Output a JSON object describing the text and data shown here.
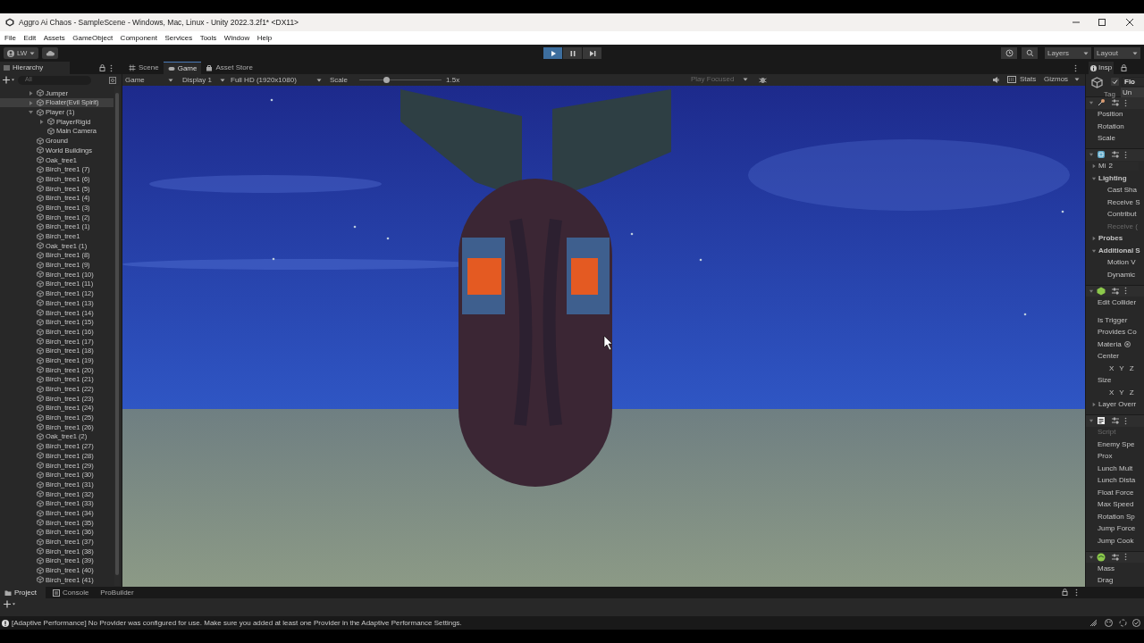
{
  "window": {
    "title": "Aggro Ai Chaos - SampleScene - Windows, Mac, Linux - Unity 2022.3.2f1* <DX11>"
  },
  "menu": [
    "File",
    "Edit",
    "Assets",
    "GameObject",
    "Component",
    "Services",
    "Tools",
    "Window",
    "Help"
  ],
  "toolbar": {
    "account": "LW",
    "play_buttons": [
      {
        "kind": "play",
        "active": true
      },
      {
        "kind": "pause",
        "active": false
      },
      {
        "kind": "step",
        "active": false
      }
    ],
    "layers": "Layers",
    "layout": "Layout"
  },
  "hierarchy": {
    "title": "Hierarchy",
    "search_placeholder": "All",
    "items": [
      {
        "label": "Jumper",
        "expanded": false,
        "selected": false
      },
      {
        "label": "Floater(Evil Spirit)",
        "expanded": false,
        "selected": true
      },
      {
        "label": "Player (1)",
        "expanded": true,
        "selected": false,
        "children": [
          {
            "label": "PlayerRigid",
            "expanded": false,
            "selected": false
          },
          {
            "label": "Main Camera",
            "selected": false
          }
        ]
      },
      {
        "label": "Ground",
        "selected": false
      },
      {
        "label": "World Buildings",
        "selected": false
      },
      {
        "label": "Oak_tree1",
        "selected": false
      },
      {
        "label": "Birch_tree1 (7)",
        "selected": false
      },
      {
        "label": "Birch_tree1 (6)",
        "selected": false
      },
      {
        "label": "Birch_tree1 (5)",
        "selected": false
      },
      {
        "label": "Birch_tree1 (4)",
        "selected": false
      },
      {
        "label": "Birch_tree1 (3)",
        "selected": false
      },
      {
        "label": "Birch_tree1 (2)",
        "selected": false
      },
      {
        "label": "Birch_tree1 (1)",
        "selected": false
      },
      {
        "label": "Birch_tree1",
        "selected": false
      },
      {
        "label": "Oak_tree1 (1)",
        "selected": false
      },
      {
        "label": "Birch_tree1 (8)",
        "selected": false
      },
      {
        "label": "Birch_tree1 (9)",
        "selected": false
      },
      {
        "label": "Birch_tree1 (10)",
        "selected": false
      },
      {
        "label": "Birch_tree1 (11)",
        "selected": false
      },
      {
        "label": "Birch_tree1 (12)",
        "selected": false
      },
      {
        "label": "Birch_tree1 (13)",
        "selected": false
      },
      {
        "label": "Birch_tree1 (14)",
        "selected": false
      },
      {
        "label": "Birch_tree1 (15)",
        "selected": false
      },
      {
        "label": "Birch_tree1 (16)",
        "selected": false
      },
      {
        "label": "Birch_tree1 (17)",
        "selected": false
      },
      {
        "label": "Birch_tree1 (18)",
        "selected": false
      },
      {
        "label": "Birch_tree1 (19)",
        "selected": false
      },
      {
        "label": "Birch_tree1 (20)",
        "selected": false
      },
      {
        "label": "Birch_tree1 (21)",
        "selected": false
      },
      {
        "label": "Birch_tree1 (22)",
        "selected": false
      },
      {
        "label": "Birch_tree1 (23)",
        "selected": false
      },
      {
        "label": "Birch_tree1 (24)",
        "selected": false
      },
      {
        "label": "Birch_tree1 (25)",
        "selected": false
      },
      {
        "label": "Birch_tree1 (26)",
        "selected": false
      },
      {
        "label": "Oak_tree1 (2)",
        "selected": false
      },
      {
        "label": "Birch_tree1 (27)",
        "selected": false
      },
      {
        "label": "Birch_tree1 (28)",
        "selected": false
      },
      {
        "label": "Birch_tree1 (29)",
        "selected": false
      },
      {
        "label": "Birch_tree1 (30)",
        "selected": false
      },
      {
        "label": "Birch_tree1 (31)",
        "selected": false
      },
      {
        "label": "Birch_tree1 (32)",
        "selected": false
      },
      {
        "label": "Birch_tree1 (33)",
        "selected": false
      },
      {
        "label": "Birch_tree1 (34)",
        "selected": false
      },
      {
        "label": "Birch_tree1 (35)",
        "selected": false
      },
      {
        "label": "Birch_tree1 (36)",
        "selected": false
      },
      {
        "label": "Birch_tree1 (37)",
        "selected": false
      },
      {
        "label": "Birch_tree1 (38)",
        "selected": false
      },
      {
        "label": "Birch_tree1 (39)",
        "selected": false
      },
      {
        "label": "Birch_tree1 (40)",
        "selected": false
      },
      {
        "label": "Birch_tree1 (41)",
        "selected": false
      }
    ]
  },
  "game_view": {
    "tabs": [
      {
        "kind": "scene",
        "label": "Scene",
        "selected": false
      },
      {
        "kind": "game",
        "label": "Game",
        "selected": true
      },
      {
        "kind": "store",
        "label": "Asset Store",
        "selected": false
      }
    ],
    "view_mode": "Game",
    "display": "Display 1",
    "resolution": "Full HD (1920x1080)",
    "scale_label": "Scale",
    "scale": {
      "level": 0.33
    },
    "scale_value": "1.5x",
    "play_mode": "Play Focused",
    "stats": "Stats",
    "gizmos": "Gizmos"
  },
  "inspector": {
    "tab": "Insp",
    "object_name": "Flo",
    "active": true,
    "tag_label": "Tag",
    "tag_value": "Un",
    "components": [
      {
        "kind": "transform",
        "rows": [
          {
            "kind": "field",
            "label": "Position"
          },
          {
            "kind": "field",
            "label": "Rotation"
          },
          {
            "kind": "field",
            "label": "Scale"
          }
        ]
      },
      {
        "kind": "mesh",
        "rows": [
          {
            "kind": "value-field",
            "label": "Mi",
            "value": "2"
          },
          {
            "kind": "section",
            "label": "Lighting",
            "expanded": true
          },
          {
            "kind": "subfield",
            "label": "Cast Sha"
          },
          {
            "kind": "subfield",
            "label": "Receive S"
          },
          {
            "kind": "subfield",
            "label": "Contribut"
          },
          {
            "kind": "disabled-subfield",
            "label": "Receive ("
          },
          {
            "kind": "section",
            "label": "Probes",
            "expanded": false
          },
          {
            "kind": "section",
            "label": "Additional S",
            "expanded": true
          },
          {
            "kind": "subfield",
            "label": "Motion V"
          },
          {
            "kind": "subfield",
            "label": "Dynamic"
          }
        ]
      },
      {
        "kind": "collider",
        "rows": [
          {
            "kind": "button",
            "label": "Edit Collider"
          },
          {
            "kind": "field",
            "label": "Is Trigger"
          },
          {
            "kind": "field",
            "label": "Provides Co"
          },
          {
            "kind": "object-field",
            "label": "Materia"
          },
          {
            "kind": "field",
            "label": "Center"
          },
          {
            "kind": "vector",
            "axes": [
              "X",
              "Y",
              "Z"
            ]
          },
          {
            "kind": "field",
            "label": "Size"
          },
          {
            "kind": "vector",
            "axes": [
              "X",
              "Y",
              "Z"
            ]
          },
          {
            "kind": "foldout",
            "label": "Layer Overr",
            "expanded": false
          }
        ]
      },
      {
        "kind": "script",
        "rows": [
          {
            "kind": "disabled-field",
            "label": "Script"
          },
          {
            "kind": "field",
            "label": "Enemy Spe"
          },
          {
            "kind": "field",
            "label": "Prox"
          },
          {
            "kind": "field",
            "label": "Lunch Mult"
          },
          {
            "kind": "field",
            "label": "Lunch Dista"
          },
          {
            "kind": "field",
            "label": "Float Force"
          },
          {
            "kind": "field",
            "label": "Max Speed"
          },
          {
            "kind": "field",
            "label": "Rotation Sp"
          },
          {
            "kind": "field",
            "label": "Jump Force"
          },
          {
            "kind": "field",
            "label": "Jump Cook"
          }
        ]
      },
      {
        "kind": "rigidbody",
        "rows": [
          {
            "kind": "field",
            "label": "Mass"
          },
          {
            "kind": "field",
            "label": "Drag"
          }
        ]
      }
    ]
  },
  "bottom_panel": {
    "tabs": [
      {
        "kind": "project",
        "label": "Project",
        "selected": true
      },
      {
        "kind": "console",
        "label": "Console",
        "selected": false
      },
      {
        "kind": "plain",
        "label": "ProBuilder",
        "selected": false
      }
    ]
  },
  "status_bar": {
    "message": "[Adaptive Performance] No Provider was configured for use. Make sure you added at least one Provider in the Adaptive Performance Settings."
  }
}
